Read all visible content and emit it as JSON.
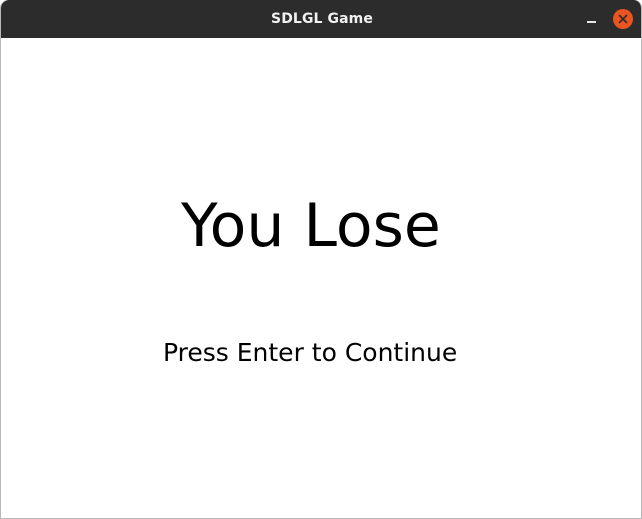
{
  "window": {
    "title": "SDLGL Game"
  },
  "controls": {
    "minimize_icon": "minimize-icon",
    "close_icon": "close-icon",
    "close_color": "#e95420"
  },
  "game": {
    "headline": "You Lose",
    "prompt": "Press Enter to Continue",
    "background": "#ffffff",
    "text_color": "#000000"
  }
}
